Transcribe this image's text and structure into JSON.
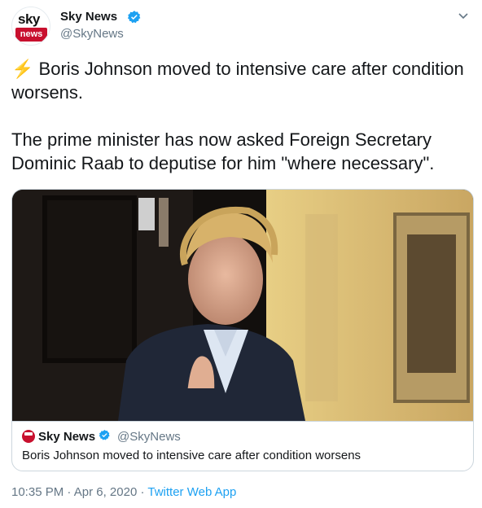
{
  "author": {
    "avatar_top": "sky",
    "avatar_bottom": "news",
    "display_name": "Sky News",
    "handle": "@SkyNews",
    "verified": true
  },
  "tweet": {
    "bolt_emoji": "⚡",
    "line1": "Boris Johnson moved to intensive care after condition worsens.",
    "line2": "The prime minister has now asked Foreign Secretary Dominic Raab to deputise for him \"where necessary\"."
  },
  "card": {
    "source_name": "Sky News",
    "source_handle": "@SkyNews",
    "title": "Boris Johnson moved to intensive care after condition worsens"
  },
  "meta": {
    "time": "10:35 PM",
    "separator1": "·",
    "date": "Apr 6, 2020",
    "separator2": "·",
    "app": "Twitter Web App"
  },
  "colors": {
    "accent": "#1da1f2",
    "sky_red": "#c8102e",
    "text": "#14171a",
    "muted": "#657786",
    "border": "#ccd6dd"
  },
  "icons": {
    "verified": "verified-badge-icon",
    "caret": "chevron-down-icon"
  }
}
